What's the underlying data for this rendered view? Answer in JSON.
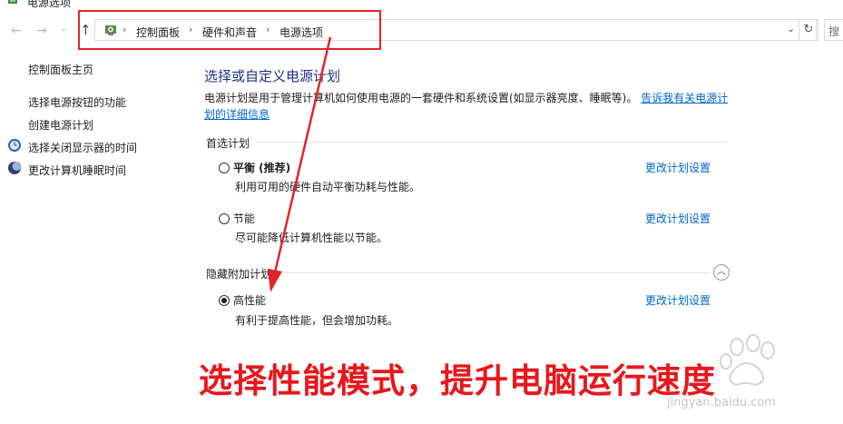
{
  "window": {
    "title": "电源选项"
  },
  "address_bar": {
    "breadcrumbs": [
      "控制面板",
      "硬件和声音",
      "电源选项"
    ],
    "search_text": "搜"
  },
  "sidebar": {
    "items": [
      {
        "label": "控制面板主页",
        "icon": ""
      },
      {
        "label": "选择电源按钮的功能",
        "icon": ""
      },
      {
        "label": "创建电源计划",
        "icon": ""
      },
      {
        "label": "选择关闭显示器的时间",
        "icon": "monitor-clock-icon"
      },
      {
        "label": "更改计算机睡眠时间",
        "icon": "moon-icon"
      }
    ]
  },
  "main": {
    "heading": "选择或自定义电源计划",
    "description": "电源计划是用于管理计算机如何使用电源的一套硬件和系统设置(如显示器亮度、睡眠等)。",
    "description_link": "告诉我有关电源计划的详细信息",
    "preferred_group": "首选计划",
    "hidden_group": "隐藏附加计划",
    "plans": [
      {
        "name": "平衡 (推荐)",
        "description": "利用可用的硬件自动平衡功耗与性能。",
        "link": "更改计划设置",
        "selected": false
      },
      {
        "name": "节能",
        "description": "尽可能降低计算机性能以节能。",
        "link": "更改计划设置",
        "selected": false
      },
      {
        "name": "高性能",
        "description": "有利于提高性能，但会增加功耗。",
        "link": "更改计划设置",
        "selected": true
      }
    ]
  },
  "annotation": {
    "caption": "选择性能模式，提升电脑运行速度",
    "color": "#e2262a"
  },
  "watermark": {
    "text": "jingyan.baidu.com"
  }
}
